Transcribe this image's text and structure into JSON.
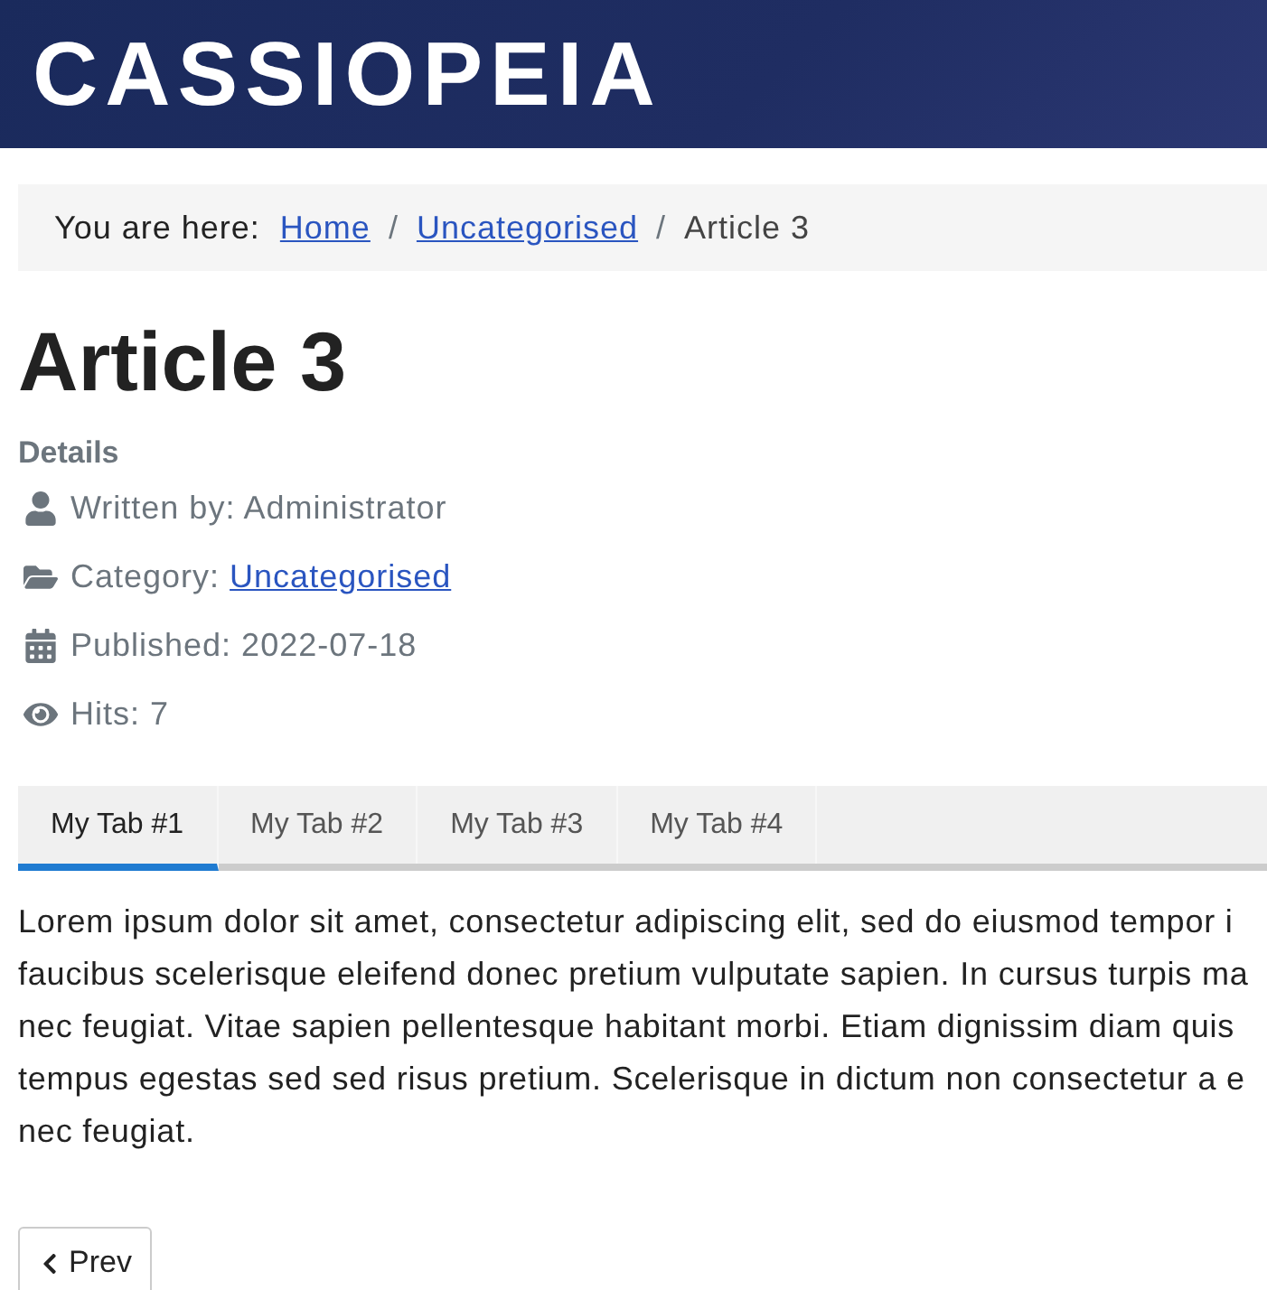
{
  "header": {
    "logo": "CASSIOPEIA"
  },
  "breadcrumb": {
    "label": "You are here:",
    "items": [
      {
        "text": "Home",
        "kind": "link"
      },
      {
        "text": "/",
        "kind": "separator"
      },
      {
        "text": "Uncategorised",
        "kind": "link"
      },
      {
        "text": "/",
        "kind": "separator"
      },
      {
        "text": "Article 3",
        "kind": "current"
      }
    ]
  },
  "article": {
    "title": "Article 3",
    "details_heading": "Details",
    "details": [
      {
        "kind": "author",
        "label": "Written by: Administrator"
      },
      {
        "kind": "category",
        "label": "Category: ",
        "link": "Uncategorised"
      },
      {
        "kind": "published",
        "label": "Published: 2022-07-18"
      },
      {
        "kind": "hits",
        "label": "Hits: 7"
      }
    ],
    "tabs": [
      {
        "label": "My Tab #1",
        "selected": true
      },
      {
        "label": "My Tab #2",
        "selected": false
      },
      {
        "label": "My Tab #3",
        "selected": false
      },
      {
        "label": "My Tab #4",
        "selected": false
      }
    ],
    "text_lines": [
      "Lorem ipsum dolor sit amet, consectetur adipiscing elit, sed do eiusmod tempor i",
      "faucibus scelerisque eleifend donec pretium vulputate sapien. In cursus turpis ma",
      "nec feugiat. Vitae sapien pellentesque habitant morbi. Etiam dignissim diam quis",
      "tempus egestas sed sed risus pretium. Scelerisque in dictum non consectetur a e",
      "nec feugiat."
    ],
    "prev_button": "Prev"
  }
}
